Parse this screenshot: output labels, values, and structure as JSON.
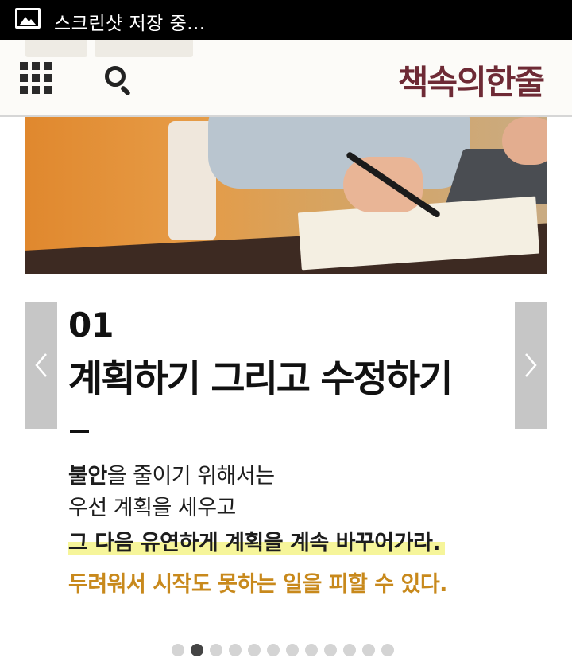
{
  "status_bar": {
    "message": "스크린샷 저장 중..."
  },
  "header": {
    "logo": "책속의한줄"
  },
  "slide": {
    "number": "01",
    "title": "계획하기 그리고 수정하기",
    "body": {
      "line1_bold": "불안",
      "line1_rest": "을 줄이기 위해서는",
      "line2": "우선 계획을 세우고",
      "line3": "그 다음 유연하게 계획을 계속 바꾸어가라.",
      "line4": "두려워서 시작도 못하는 일을 피할 수 있다."
    }
  },
  "pagination": {
    "total": 12,
    "active_index": 1
  },
  "colors": {
    "logo": "#6e2a35",
    "highlight": "#f6f59a",
    "accent_text": "#c8891c",
    "arrow_bg": "#c6c6c6"
  },
  "icons": [
    "image-icon",
    "grid-menu-icon",
    "search-icon",
    "chevron-left-icon",
    "chevron-right-icon"
  ]
}
